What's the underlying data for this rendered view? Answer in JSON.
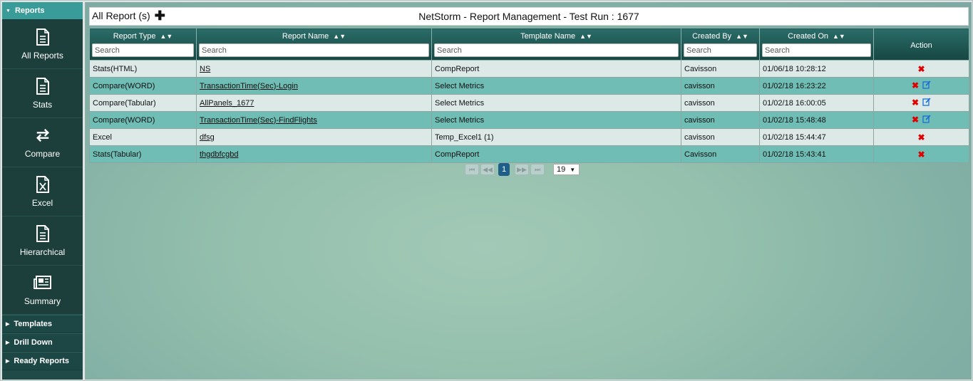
{
  "sidebar": {
    "reports_header": "Reports",
    "items": [
      {
        "label": "All Reports",
        "icon": "document-icon"
      },
      {
        "label": "Stats",
        "icon": "document-icon"
      },
      {
        "label": "Compare",
        "icon": "swap-arrows-icon"
      },
      {
        "label": "Excel",
        "icon": "excel-file-icon"
      },
      {
        "label": "Hierarchical",
        "icon": "document-icon"
      },
      {
        "label": "Summary",
        "icon": "newspaper-icon"
      }
    ],
    "collapsed_sections": [
      "Templates",
      "Drill Down",
      "Ready Reports"
    ]
  },
  "header": {
    "left_title": "All Report (s)",
    "center_title": "NetStorm - Report Management - Test Run : 1677"
  },
  "table": {
    "columns": [
      "Report Type",
      "Report Name",
      "Template Name",
      "Created By",
      "Created On",
      "Action"
    ],
    "search_placeholder": "Search",
    "rows": [
      {
        "type": "Stats(HTML)",
        "name": "NS",
        "template": "CompReport",
        "by": "Cavisson",
        "on": "01/06/18 10:28:12",
        "edit": false
      },
      {
        "type": "Compare(WORD)",
        "name": "TransactionTime(Sec)-Login",
        "template": "Select Metrics",
        "by": "cavisson",
        "on": "01/02/18 16:23:22",
        "edit": true
      },
      {
        "type": "Compare(Tabular)",
        "name": "AllPanels_1677",
        "template": "Select Metrics",
        "by": "cavisson",
        "on": "01/02/18 16:00:05",
        "edit": true
      },
      {
        "type": "Compare(WORD)",
        "name": "TransactionTime(Sec)-FindFlights",
        "template": "Select Metrics",
        "by": "cavisson",
        "on": "01/02/18 15:48:48",
        "edit": true
      },
      {
        "type": "Excel",
        "name": "dfsg",
        "template": "Temp_Excel1 (1)",
        "by": "cavisson",
        "on": "01/02/18 15:44:47",
        "edit": false
      },
      {
        "type": "Stats(Tabular)",
        "name": "thgdbfcgbd",
        "template": "CompReport",
        "by": "Cavisson",
        "on": "01/02/18 15:43:41",
        "edit": false
      }
    ]
  },
  "pagination": {
    "current_page": "1",
    "rows_per_page": "19"
  },
  "colors": {
    "sidebar_bg": "#1f4a47",
    "active_header": "#3a9c99",
    "row_odd": "#dde9e7",
    "row_even": "#6fbdb4",
    "delete": "#e00000",
    "edit": "#1a6fd6",
    "page_active": "#1e5f8a"
  }
}
